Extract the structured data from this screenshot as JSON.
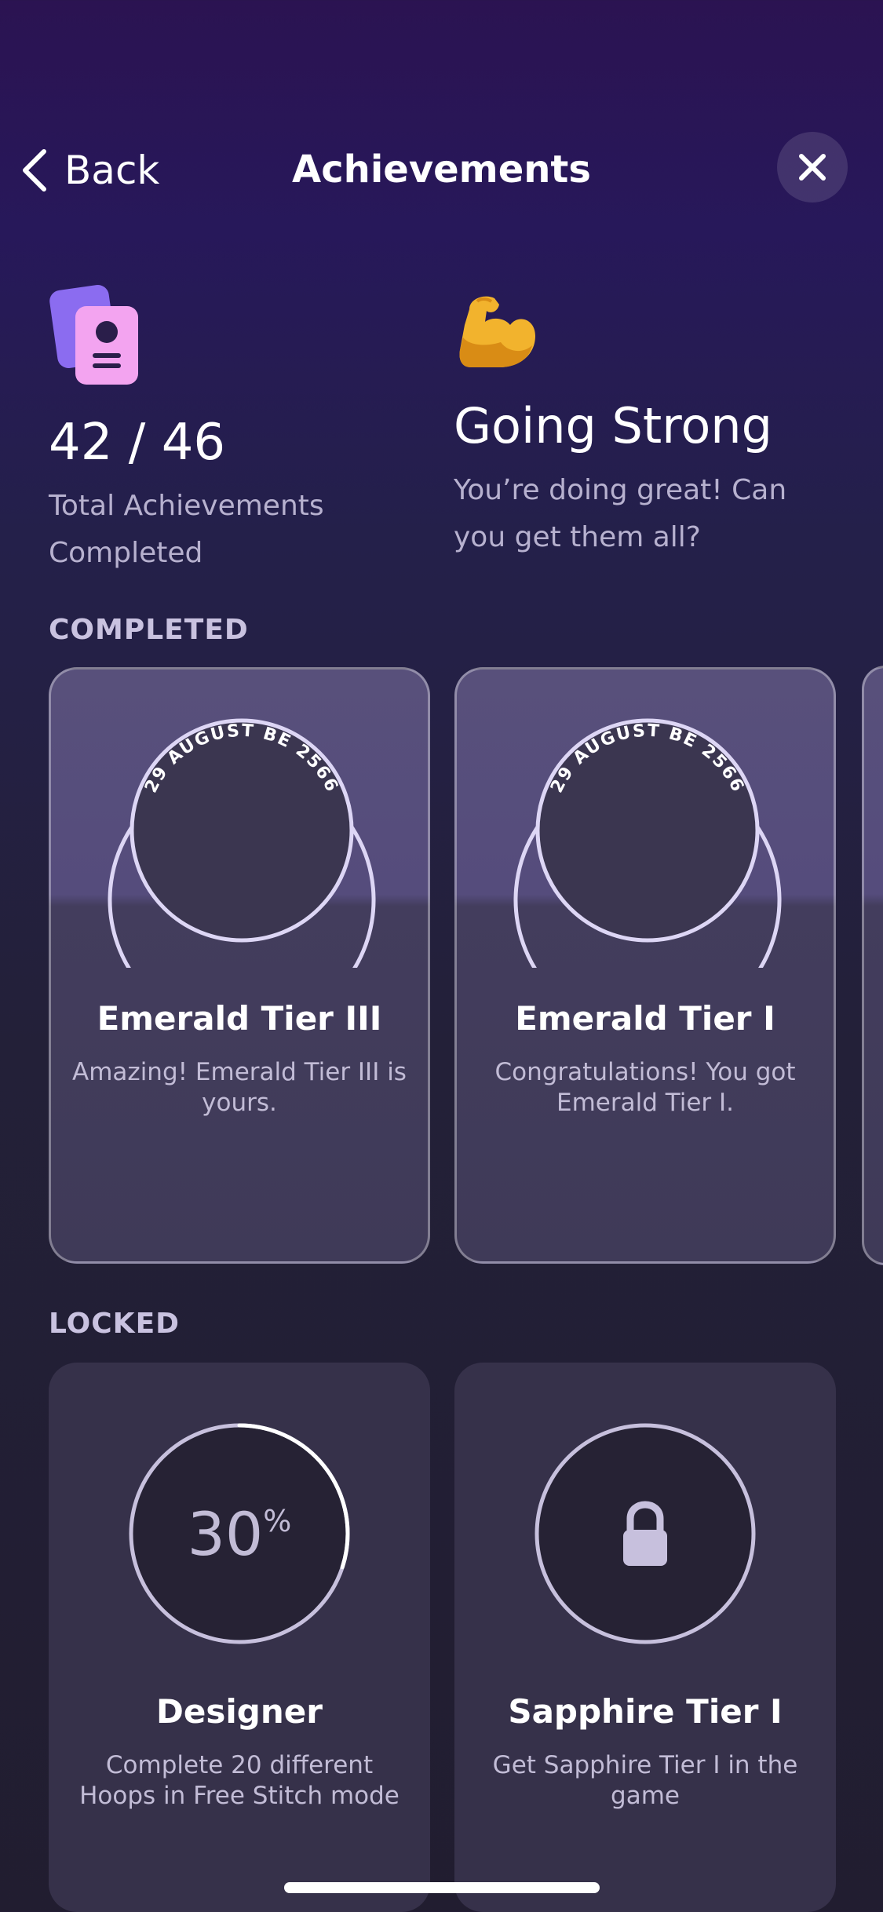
{
  "nav": {
    "back_label": "Back",
    "title": "Achievements"
  },
  "summary": {
    "count": "42 / 46",
    "count_label": "Total Achievements Completed",
    "status_title": "Going Strong",
    "status_subtitle": "You’re doing great! Can you get them all?",
    "status_emoji": "💪"
  },
  "completed": {
    "section_label": "COMPLETED",
    "items": [
      {
        "date": "29 AUGUST BE 2566",
        "title": "Emerald Tier III",
        "description": "Amazing! Emerald Tier III is yours."
      },
      {
        "date": "29 AUGUST BE 2566",
        "title": "Emerald Tier I",
        "description": "Congratulations! You got Emerald Tier I."
      }
    ]
  },
  "locked": {
    "section_label": "LOCKED",
    "items": [
      {
        "progress_value": "30",
        "progress_unit": "%",
        "progress_fraction": 0.3,
        "title": "Designer",
        "description": "Complete 20 different Hoops in Free Stitch mode"
      },
      {
        "icon": "lock-icon",
        "title": "Sapphire Tier I",
        "description": "Get Sapphire Tier I in the game"
      }
    ]
  },
  "colors": {
    "accent_purple": "#8b6cf0",
    "accent_pink": "#f3a4f0",
    "ring": "#ddd6f5"
  }
}
